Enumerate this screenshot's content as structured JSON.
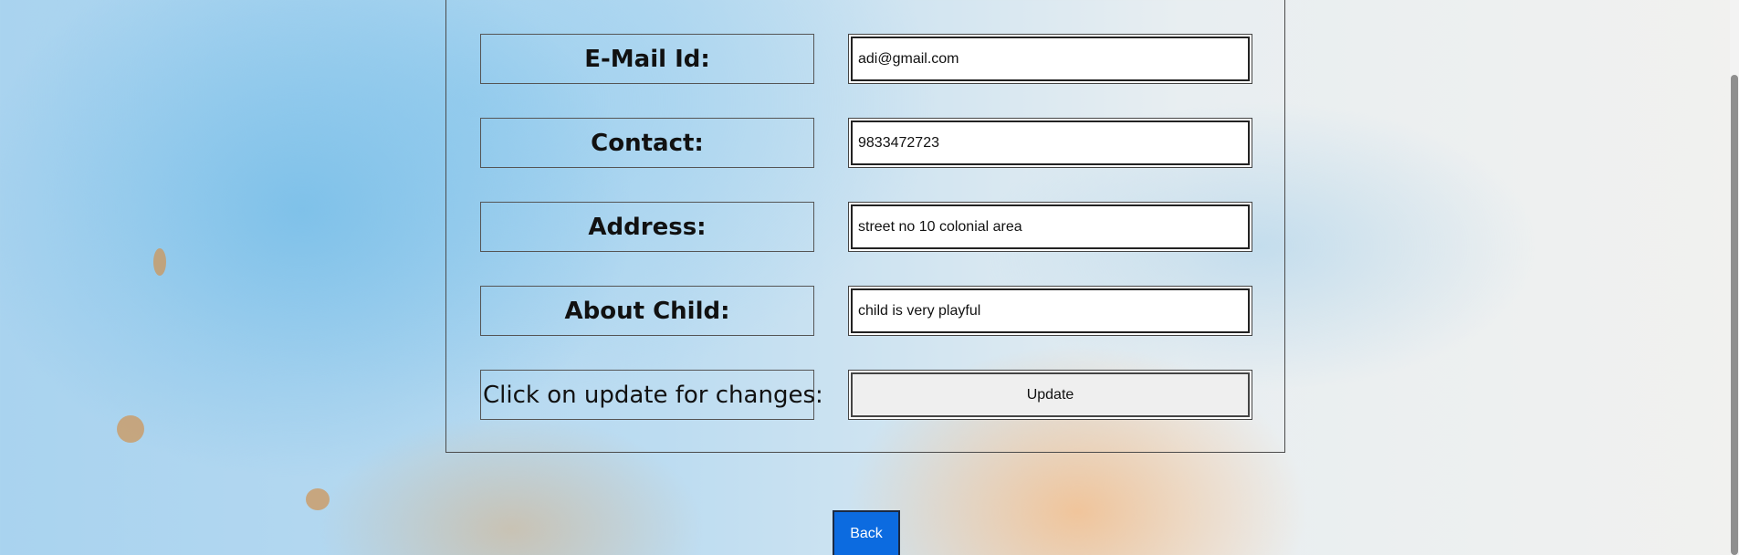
{
  "form": {
    "email": {
      "label": "E-Mail Id:",
      "value": "adi@gmail.com"
    },
    "contact": {
      "label": "Contact:",
      "value": "9833472723"
    },
    "address": {
      "label": "Address:",
      "value": "street no 10 colonial area"
    },
    "about_child": {
      "label": "About Child:",
      "value": "child is very playful"
    },
    "update": {
      "label": "Click on update for changes:",
      "button": "Update"
    }
  },
  "back_button": "Back",
  "colors": {
    "back_button": "#0c6be0",
    "panel_border": "#4b4b4b"
  }
}
